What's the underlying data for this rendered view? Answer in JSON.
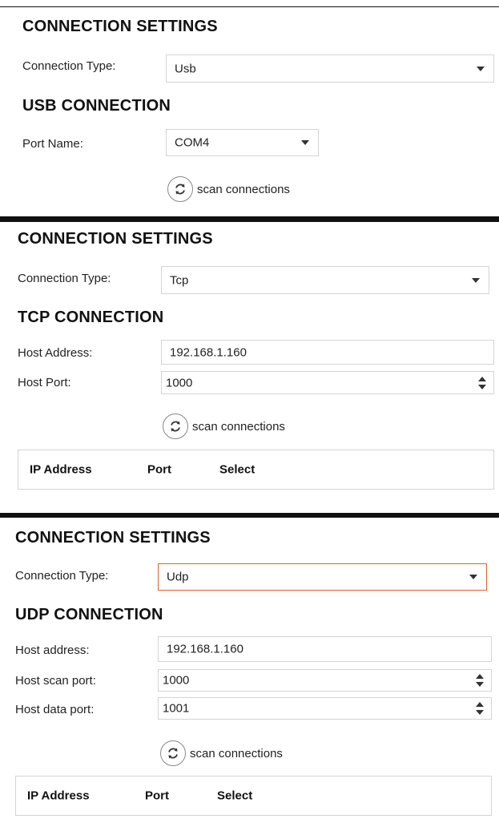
{
  "panels": {
    "usb": {
      "title": "CONNECTION SETTINGS",
      "connection_type_label": "Connection Type:",
      "connection_type_value": "Usb",
      "section_title": "USB CONNECTION",
      "port_name_label": "Port Name:",
      "port_name_value": "COM4",
      "scan_label": "scan connections"
    },
    "tcp": {
      "title": "CONNECTION SETTINGS",
      "connection_type_label": "Connection Type:",
      "connection_type_value": "Tcp",
      "section_title": "TCP CONNECTION",
      "host_address_label": "Host Address:",
      "host_address_value": "192.168.1.160",
      "host_port_label": "Host Port:",
      "host_port_value": "1000",
      "scan_label": "scan connections",
      "table_headers": [
        "IP Address",
        "Port",
        "Select"
      ]
    },
    "udp": {
      "title": "CONNECTION SETTINGS",
      "connection_type_label": "Connection Type:",
      "connection_type_value": "Udp",
      "section_title": "UDP CONNECTION",
      "host_address_label": "Host address:",
      "host_address_value": "192.168.1.160",
      "host_scan_port_label": "Host scan port:",
      "host_scan_port_value": "1000",
      "host_data_port_label": "Host data port:",
      "host_data_port_value": "1001",
      "scan_label": "scan connections",
      "table_headers": [
        "IP Address",
        "Port",
        "Select"
      ]
    }
  },
  "icons": {
    "dropdown": "chevron-down-icon",
    "spinner": "spinner-arrows-icon",
    "scan": "refresh-icon"
  },
  "colors": {
    "focus_border": "#e2632a",
    "divider": "#111111",
    "border": "#d4d4d4"
  }
}
